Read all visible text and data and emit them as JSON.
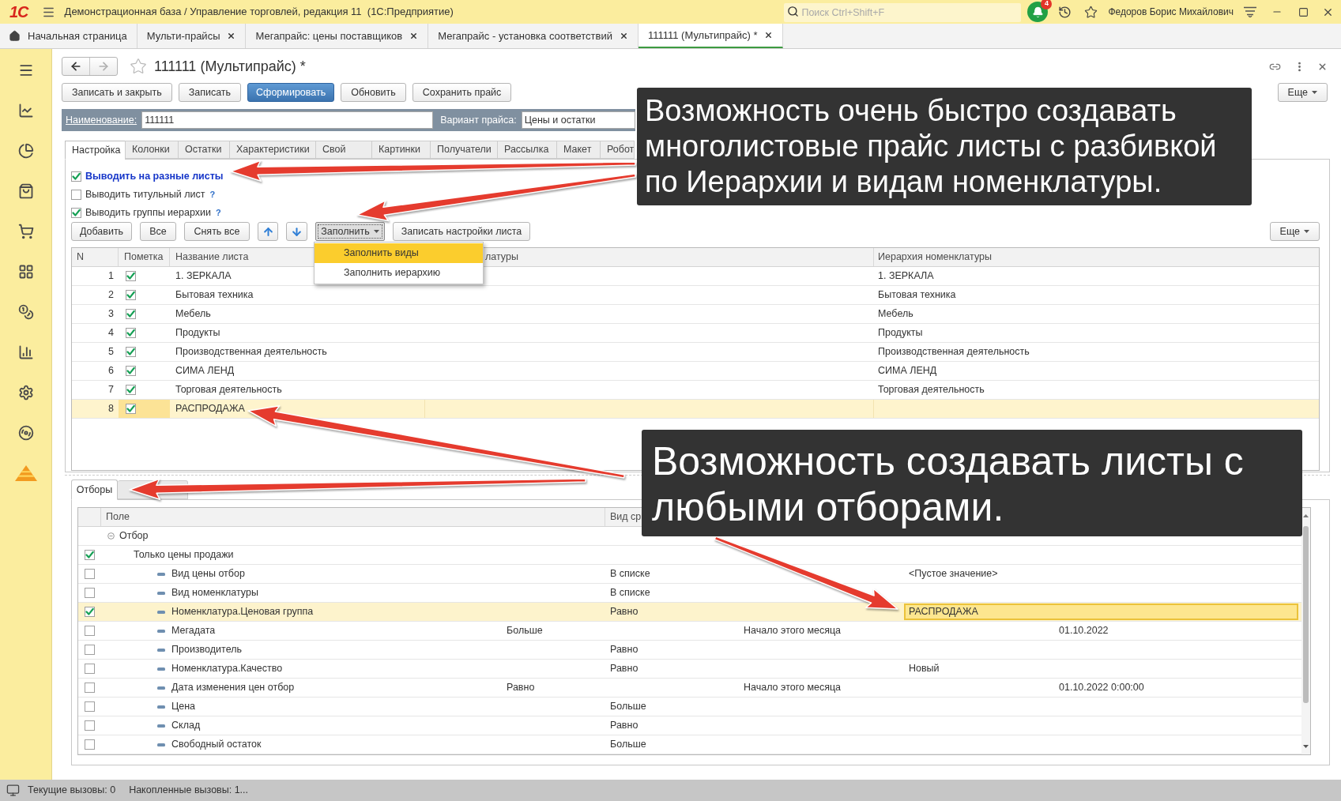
{
  "app": {
    "logo": "1С",
    "title": "Демонстрационная база / Управление торговлей, редакция 11  (1С:Предприятие)",
    "search": {
      "placeholder": "Поиск Ctrl+Shift+F"
    },
    "notifications": "4",
    "user": "Федоров Борис Михайлович"
  },
  "open_tabs": {
    "home": "Начальная страница",
    "tabs": [
      {
        "label": "Мульти-прайсы",
        "selected": false
      },
      {
        "label": "Мегапрайс: цены поставщиков",
        "selected": false
      },
      {
        "label": "Мегапрайс - установка соответствий",
        "selected": false
      },
      {
        "label": "111111 (Мультипрайс) *",
        "selected": true
      }
    ]
  },
  "form": {
    "nav": {
      "back_disabled": false,
      "forward_disabled": true
    },
    "title": "111111 (Мультипрайс) *",
    "toolbar": [
      {
        "label": "Записать и закрыть",
        "kind": "normal"
      },
      {
        "label": "Записать",
        "kind": "normal"
      },
      {
        "label": "Сформировать",
        "kind": "primary"
      },
      {
        "label": "Обновить",
        "kind": "normal"
      },
      {
        "label": "Сохранить прайс",
        "kind": "normal"
      }
    ],
    "more": "Еще",
    "name": {
      "label": "Наименование:",
      "value": "111111"
    },
    "price_variant": {
      "label": "Вариант прайса:",
      "value": "Цены и остатки"
    },
    "tabs": [
      {
        "label": "Настройка",
        "selected": true
      },
      {
        "label": "Колонки",
        "selected": false
      },
      {
        "label": "Остатки",
        "selected": false
      },
      {
        "label": "Характеристики",
        "selected": false
      },
      {
        "label": "Свой",
        "selected": false
      },
      {
        "label": "Картинки",
        "selected": false
      },
      {
        "label": "Получатели",
        "selected": false
      },
      {
        "label": "Рассылка",
        "selected": false
      },
      {
        "label": "Макет",
        "selected": false
      },
      {
        "label": "Робот",
        "selected": false
      }
    ],
    "options": [
      {
        "label": "Выводить на разные листы",
        "checked": true,
        "emphasized": true
      },
      {
        "label": "Выводить титульный лист",
        "checked": false,
        "emphasized": false,
        "help": "?"
      },
      {
        "label": "Выводить группы иерархии",
        "checked": true,
        "emphasized": false,
        "help": "?"
      }
    ],
    "sheets": {
      "toolbar": [
        {
          "kind": "text",
          "label": "Добавить"
        },
        {
          "kind": "text",
          "label": "Все"
        },
        {
          "kind": "text",
          "label": "Снять все"
        },
        {
          "kind": "up"
        },
        {
          "kind": "down"
        },
        {
          "kind": "dropdown",
          "label": "Заполнить",
          "expanded": true
        },
        {
          "kind": "text",
          "label": "Записать настройки листа"
        }
      ],
      "more": "Еще",
      "fill_menu": [
        {
          "label": "Заполнить виды",
          "selected": true
        },
        {
          "label": "Заполнить иерархию",
          "selected": false
        }
      ],
      "columns": [
        "N",
        "Пометка",
        "Название листа",
        "латуры",
        "Иерархия номенклатуры"
      ],
      "rows": [
        {
          "n": "1",
          "checked": true,
          "name": "1. ЗЕРКАЛА",
          "hierarchy": "1. ЗЕРКАЛА",
          "selected": false
        },
        {
          "n": "2",
          "checked": true,
          "name": "Бытовая техника",
          "hierarchy": "Бытовая техника",
          "selected": false
        },
        {
          "n": "3",
          "checked": true,
          "name": "Мебель",
          "hierarchy": "Мебель",
          "selected": false
        },
        {
          "n": "4",
          "checked": true,
          "name": "Продукты",
          "hierarchy": "Продукты",
          "selected": false
        },
        {
          "n": "5",
          "checked": true,
          "name": "Производственная деятельность",
          "hierarchy": "Производственная деятельность",
          "selected": false
        },
        {
          "n": "6",
          "checked": true,
          "name": "СИМА ЛЕНД",
          "hierarchy": "СИМА ЛЕНД",
          "selected": false
        },
        {
          "n": "7",
          "checked": true,
          "name": "Торговая деятельность",
          "hierarchy": "Торговая деятельность",
          "selected": false
        },
        {
          "n": "8",
          "checked": true,
          "name": "РАСПРОДАЖА",
          "selected": true
        }
      ]
    },
    "filter": {
      "tabs": [
        {
          "label": "Отборы",
          "selected": true
        },
        {
          "selected": false
        }
      ],
      "columns": [
        "Поле",
        "Вид ср"
      ],
      "group": {
        "label": "Отбор",
        "expanded": true,
        "children": [
          {
            "kind": "flag",
            "field": "Только цены продажи",
            "checked": true,
            "selected": false
          },
          {
            "kind": "condition",
            "field": "Вид цены отбор",
            "comparison": "В списке",
            "value": "<Пустое значение>",
            "checked": false,
            "selected": false
          },
          {
            "kind": "condition",
            "field": "Вид номенклатуры",
            "comparison": "В списке",
            "checked": false,
            "selected": false
          },
          {
            "kind": "condition",
            "field": "Номенклатура.Ценовая группа",
            "comparison": "Равно",
            "value": "РАСПРОДАЖА",
            "checked": true,
            "selected": true
          },
          {
            "kind": "period",
            "field": "Мегадата",
            "comparison": "Больше",
            "variant": "Начало этого месяца",
            "value": "01.10.2022",
            "checked": false,
            "selected": false
          },
          {
            "kind": "condition",
            "field": "Производитель",
            "comparison": "Равно",
            "checked": false,
            "selected": false
          },
          {
            "kind": "condition",
            "field": "Номенклатура.Качество",
            "comparison": "Равно",
            "value": "Новый",
            "checked": false,
            "selected": false
          },
          {
            "kind": "period",
            "field": "Дата изменения цен отбор",
            "comparison": "Равно",
            "variant": "Начало этого месяца",
            "value": "01.10.2022 0:00:00",
            "checked": false,
            "selected": false
          },
          {
            "kind": "condition",
            "field": "Цена",
            "comparison": "Больше",
            "checked": false,
            "selected": false
          },
          {
            "kind": "condition",
            "field": "Склад",
            "comparison": "Равно",
            "checked": false,
            "selected": false
          },
          {
            "kind": "condition",
            "field": "Свободный остаток",
            "comparison": "Больше",
            "checked": false,
            "selected": false
          }
        ]
      }
    }
  },
  "captions": [
    {
      "text": "Возможность очень быстро создавать многолистовые прайс листы с разбивкой по Иерархии и видам номенклатуры."
    },
    {
      "text": "Возможность создавать листы с любыми отборами."
    }
  ],
  "status_bar": [
    "Текущие вызовы: 0",
    "Накопленные вызовы: 1..."
  ]
}
